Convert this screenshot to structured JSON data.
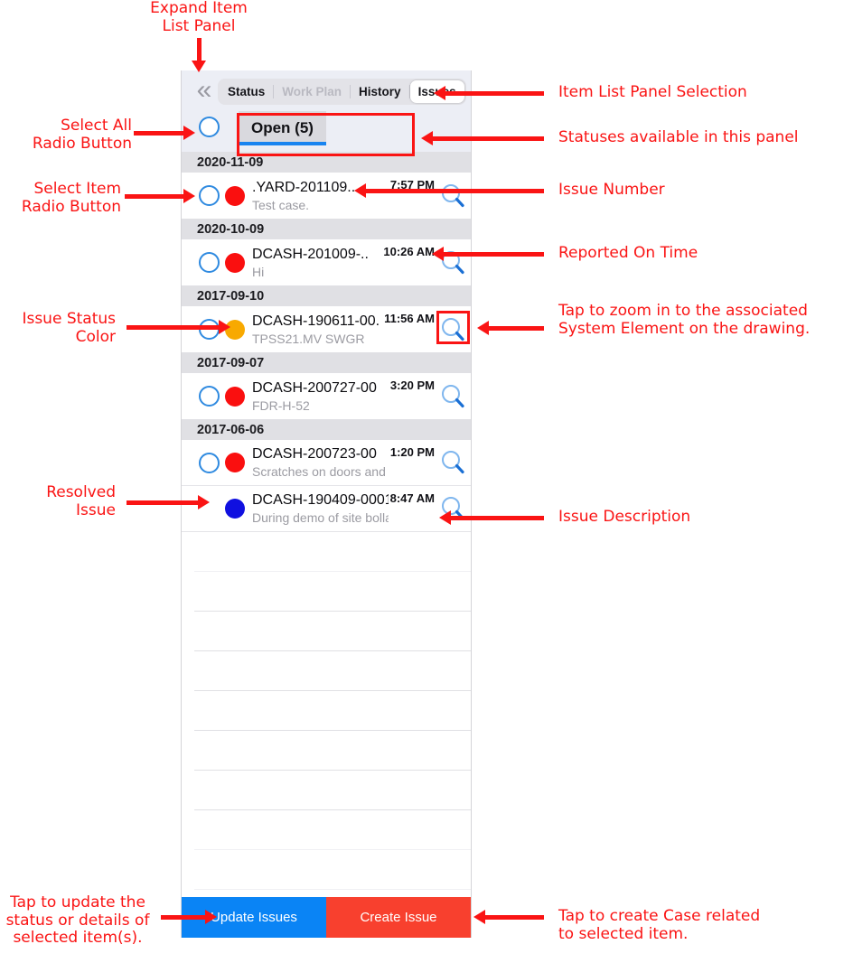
{
  "panel": {
    "expand_icon": "double-chevron-left-icon",
    "tabs": [
      {
        "label": "Status",
        "state": "normal"
      },
      {
        "label": "Work Plan",
        "state": "disabled"
      },
      {
        "label": "History",
        "state": "normal"
      },
      {
        "label": "Issues",
        "state": "selected"
      }
    ],
    "status_tabs": [
      {
        "label": "Open (5)",
        "selected": true
      }
    ],
    "select_all_label": "Select All"
  },
  "list": {
    "groups": [
      {
        "date": "2020-11-09",
        "items": [
          {
            "number": ".YARD-201109...",
            "description": "Test case.",
            "time": "7:57 PM",
            "status_color": "#fa0f0f",
            "has_radio": true,
            "zoom_icon": "magnifier-icon"
          }
        ]
      },
      {
        "date": "2020-10-09",
        "items": [
          {
            "number": "DCASH-201009-..",
            "description": "Hi",
            "time": "10:26 AM",
            "status_color": "#fa0f0f",
            "has_radio": true,
            "zoom_icon": "magnifier-icon"
          }
        ]
      },
      {
        "date": "2017-09-10",
        "items": [
          {
            "number": "DCASH-190611-00.",
            "description": "TPSS21.MV SWGR",
            "time": "11:56 AM",
            "status_color": "#f8a900",
            "has_radio": true,
            "zoom_icon": "magnifier-icon"
          }
        ]
      },
      {
        "date": "2017-09-07",
        "items": [
          {
            "number": "DCASH-200727-00",
            "description": "FDR-H-52",
            "time": "3:20 PM",
            "status_color": "#fa0f0f",
            "has_radio": true,
            "zoom_icon": "magnifier-icon"
          }
        ]
      },
      {
        "date": "2017-06-06",
        "items": [
          {
            "number": "DCASH-200723-00",
            "description": "Scratches on doors and sides of...",
            "time": "1:20 PM",
            "status_color": "#fa0f0f",
            "has_radio": true,
            "zoom_icon": "magnifier-icon"
          },
          {
            "number": "DCASH-190409-0001",
            "description": "During demo of site bollards on x-lin...",
            "time": "8:47 AM",
            "status_color": "#1010e0",
            "has_radio": false,
            "zoom_icon": "magnifier-icon"
          }
        ]
      }
    ]
  },
  "footer": {
    "update_label": "Update Issues",
    "create_label": "Create Issue"
  },
  "annotations": {
    "expand": "Expand Item\nList Panel",
    "select_all": "Select All\nRadio Button",
    "select_item": "Select Item\nRadio Button",
    "issue_status_color": "Issue Status\nColor",
    "resolved_issue": "Resolved\nIssue",
    "update_button": "Tap to update the\nstatus or details of\nselected item(s).",
    "panel_selection": "Item List Panel Selection",
    "statuses": "Statuses available in this panel",
    "issue_number": "Issue Number",
    "reported_on_time": "Reported On Time",
    "zoom_hint": "Tap to zoom in to the associated\nSystem Element on the drawing.",
    "issue_description": "Issue Description",
    "create_button": "Tap to create Case related\nto selected item."
  },
  "colors": {
    "accent_blue": "#0a84f5",
    "create_red": "#f8402e",
    "annotation_red": "#fa1414",
    "status_open_red": "#fa0f0f",
    "status_pending_orange": "#f8a900",
    "status_resolved_blue": "#1010e0"
  }
}
